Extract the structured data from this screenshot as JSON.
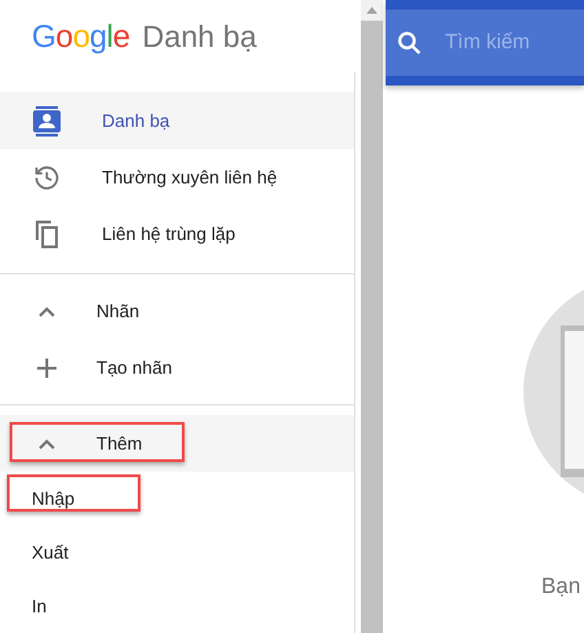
{
  "app": {
    "brand": "Google",
    "title": "Danh bạ"
  },
  "nav": [
    {
      "label": "Danh bạ",
      "kind": "contacts",
      "selected": true
    },
    {
      "label": "Thường xuyên liên hệ",
      "kind": "history",
      "selected": false
    },
    {
      "label": "Liên hệ trùng lặp",
      "kind": "copy",
      "selected": false
    }
  ],
  "labels_section": {
    "title": "Nhãn",
    "expanded": true,
    "items": [
      {
        "label": "Tạo nhãn",
        "kind": "plus"
      }
    ]
  },
  "more_section": {
    "title": "Thêm",
    "expanded": true,
    "highlighted": true,
    "items": [
      {
        "label": "Nhập",
        "highlighted": true
      },
      {
        "label": "Xuất",
        "highlighted": false
      },
      {
        "label": "In",
        "highlighted": false
      }
    ]
  },
  "search": {
    "placeholder": "Tìm kiếm"
  },
  "empty_state": {
    "text": "Bạn"
  }
}
